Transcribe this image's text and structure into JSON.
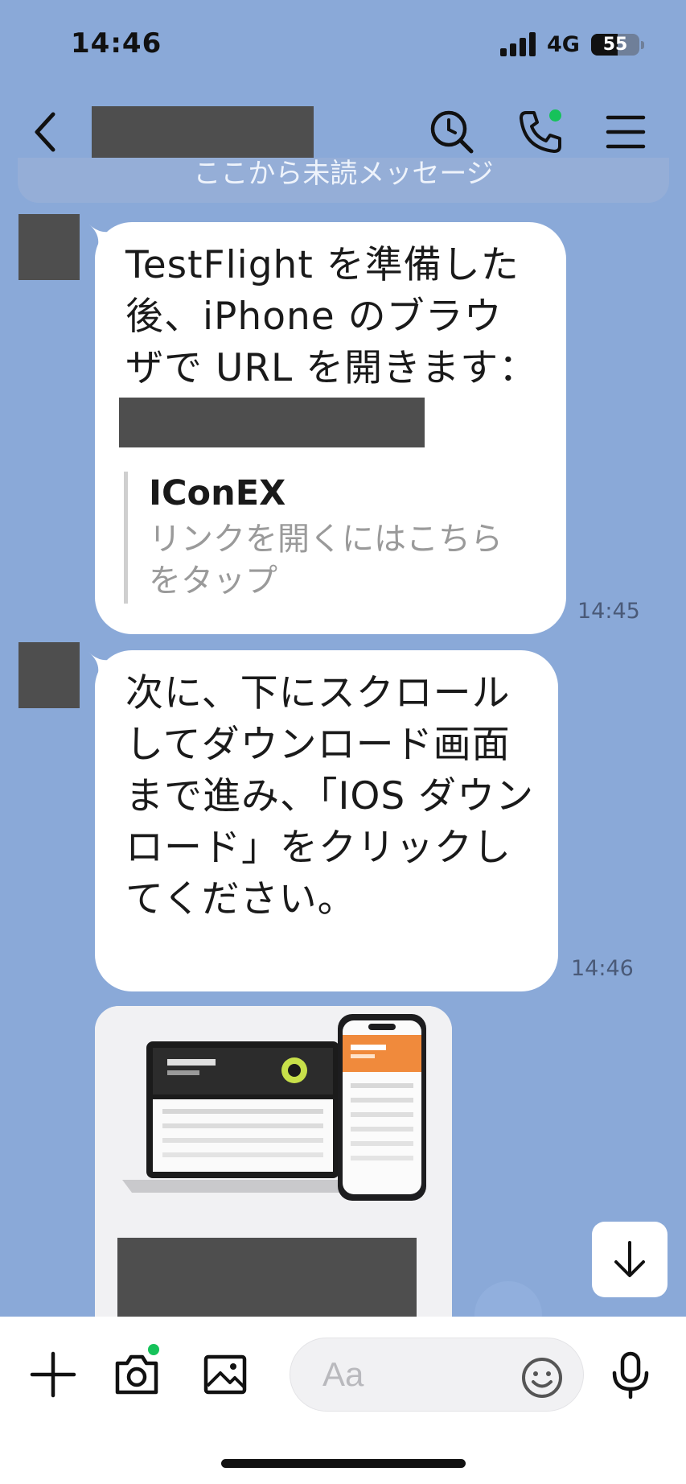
{
  "status_bar": {
    "time": "14:46",
    "network": "4G",
    "battery_level": "55",
    "battery_fraction": 0.55
  },
  "header": {
    "back_icon": "chevron-left-icon",
    "search_icon": "search-icon",
    "call_icon": "phone-icon",
    "menu_icon": "menu-icon",
    "call_badge_color": "#16c25a"
  },
  "unread_divider": {
    "text": "ここから未読メッセージ"
  },
  "messages": [
    {
      "text": "TestFlight を準備した\n後、iPhone のブラウ\nザで URL を開きます：",
      "link_preview": {
        "title": "IConEX",
        "description": "リンクを開くにはこちら\nをタップ"
      },
      "time": "14:45"
    },
    {
      "text": "次に、下にスクロール\nしてダウンロード画面\nまで進み、「IOS ダウン\nロード」をクリックし\nてください。",
      "time": "14:46"
    }
  ],
  "composer": {
    "placeholder": "Aa",
    "value": "",
    "plus_icon": "plus-icon",
    "camera_icon": "camera-icon",
    "image_icon": "image-icon",
    "emoji_icon": "emoji-icon",
    "mic_icon": "microphone-icon"
  },
  "colors": {
    "chat_background": "#8aa9d8",
    "bubble": "#ffffff",
    "accent_green": "#16c25a",
    "redaction": "#4e4e4e"
  }
}
